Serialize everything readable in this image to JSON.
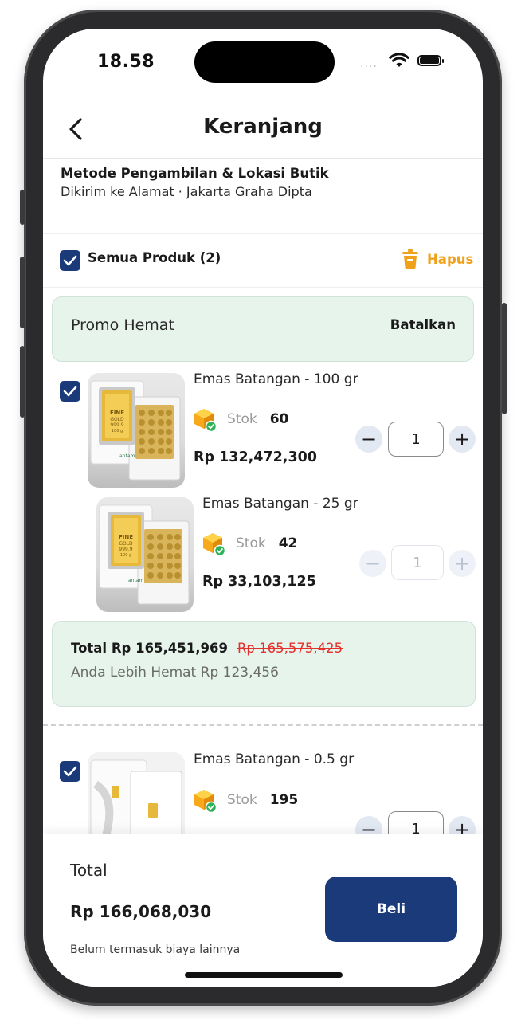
{
  "status": {
    "time": "18.58",
    "signal_dots": "...."
  },
  "header": {
    "title": "Keranjang"
  },
  "pickup": {
    "title": "Metode Pengambilan & Lokasi Butik",
    "subtitle": "Dikirim ke Alamat · Jakarta Graha Dipta"
  },
  "select_all": {
    "label": "Semua Produk (2)",
    "checked": true
  },
  "delete": {
    "label": "Hapus"
  },
  "promo": {
    "name": "Promo Hemat",
    "cancel_label": "Batalkan"
  },
  "products": [
    {
      "name": "Emas Batangan - 100 gr",
      "stock_label": "Stok",
      "stock": "60",
      "price": "Rp 132,472,300",
      "qty": "1",
      "checked": true,
      "enabled": true
    },
    {
      "name": "Emas Batangan - 25 gr",
      "stock_label": "Stok",
      "stock": "42",
      "price": "Rp 33,103,125",
      "qty": "1",
      "checked": false,
      "enabled": false
    },
    {
      "name": "Emas Batangan - 0.5 gr",
      "stock_label": "Stok",
      "stock": "195",
      "qty": "1",
      "checked": true,
      "enabled": true
    }
  ],
  "bar_labels": {
    "large": {
      "brand": "FINE",
      "sub1": "GOLD",
      "purity": "999.9",
      "weight": "100 g"
    },
    "small": {
      "brand": "FINE",
      "sub1": "GOLD",
      "purity": "999.9",
      "weight": "100 g"
    },
    "brand_mark": "antam"
  },
  "promo_total": {
    "total": "Total Rp 165,451,969",
    "original": "Rp 165,575,425",
    "savings": "Anda Lebih Hemat Rp 123,456"
  },
  "stepper": {
    "minus": "−",
    "plus": "+"
  },
  "footer": {
    "label": "Total",
    "total": "Rp 166,068,030",
    "note": "Belum termasuk biaya lainnya",
    "buy_label": "Beli"
  },
  "colors": {
    "primary": "#1b3a7a",
    "accent": "#f0a11a",
    "promo_bg": "#e6f4ec",
    "strike_red": "#e5312c"
  }
}
